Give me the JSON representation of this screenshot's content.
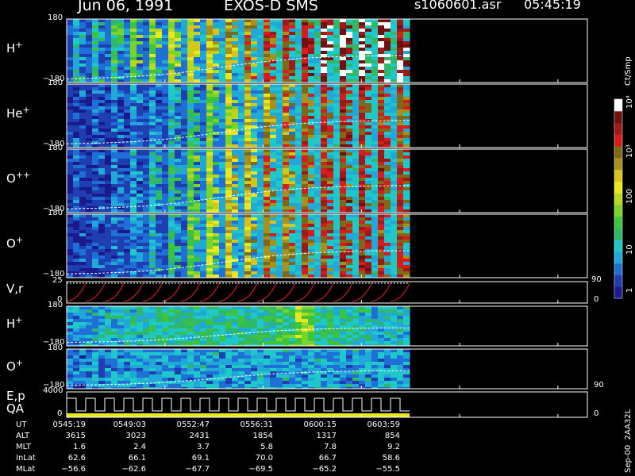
{
  "header": {
    "date": "Jun 06, 1991",
    "instrument": "EXOS-D SMS",
    "file": "s1060601.asr",
    "time": "05:45:19"
  },
  "footer_stamp": "Sep-00  2AA32L",
  "colorbar": {
    "unit": "Ct/Smp",
    "ticks": [
      "1",
      "10",
      "100",
      "10³",
      "10⁴"
    ],
    "colors": [
      "#1a1a8c",
      "#1f3fb0",
      "#1e6fd6",
      "#1fa8d8",
      "#1ec8c8",
      "#2fb86a",
      "#3cc43c",
      "#78d428",
      "#b8d81c",
      "#e8e81c",
      "#d8c418",
      "#a8901c",
      "#806818",
      "#d81c1c",
      "#a01818",
      "#701010",
      "#ffffff"
    ]
  },
  "panels": [
    {
      "label": "H",
      "sup": "+",
      "ymax": "180",
      "ymin": "−180"
    },
    {
      "label": "He",
      "sup": "+",
      "ymax": "180",
      "ymin": "−180"
    },
    {
      "label": "O",
      "sup": "++",
      "ymax": "180",
      "ymin": "−180"
    },
    {
      "label": "O",
      "sup": "+",
      "ymax": "180",
      "ymin": "−180"
    },
    {
      "label": "V,r",
      "sup": "",
      "ymax": "25",
      "ymin": "0",
      "right_top": "90",
      "right_bottom": "0"
    },
    {
      "label": "H",
      "sup": "+",
      "ymax": "180",
      "ymin": "−180"
    },
    {
      "label": "O",
      "sup": "+",
      "ymax": "180",
      "ymin": "−180",
      "right_bottom": "90"
    },
    {
      "label": "E,p",
      "label2": "QA",
      "sup": "",
      "ymax": "4000",
      "ymin": "0",
      "right_bottom": "0"
    }
  ],
  "ephemeris": {
    "rows": [
      {
        "name": "UT",
        "values": [
          "0545:19",
          "0549:03",
          "0552:47",
          "0556:31",
          "0600:15",
          "0603:59"
        ]
      },
      {
        "name": "ALT",
        "values": [
          "3615",
          "3023",
          "2431",
          "1854",
          "1317",
          "854"
        ]
      },
      {
        "name": "MLT",
        "values": [
          "1.6",
          "2.4",
          "3.7",
          "5.8",
          "7.8",
          "9.2"
        ]
      },
      {
        "name": "InLat",
        "values": [
          "62.6",
          "66.1",
          "69.1",
          "70.0",
          "66.7",
          "58.6"
        ]
      },
      {
        "name": "MLat",
        "values": [
          "−56.6",
          "−62.6",
          "−67.7",
          "−69.5",
          "−65.2",
          "−55.5"
        ]
      }
    ]
  },
  "chart_data": {
    "type": "heatmap",
    "x_label": "UT",
    "x_ticks": [
      "0545:19",
      "0549:03",
      "0552:47",
      "0556:31",
      "0600:15",
      "0603:59"
    ],
    "series": [
      {
        "name": "H+",
        "y_range": [
          -180,
          180
        ],
        "intensity_profile": [
          0.25,
          0.3,
          0.35,
          0.4,
          0.45,
          0.5,
          0.55,
          0.6,
          0.65,
          0.7,
          0.75,
          0.8,
          0.85,
          0.9,
          0.95,
          0.97,
          0.95,
          0.9
        ]
      },
      {
        "name": "He+",
        "y_range": [
          -180,
          180
        ],
        "intensity_profile": [
          0.1,
          0.12,
          0.15,
          0.18,
          0.2,
          0.25,
          0.3,
          0.4,
          0.5,
          0.6,
          0.65,
          0.7,
          0.75,
          0.78,
          0.8,
          0.8,
          0.78,
          0.75
        ]
      },
      {
        "name": "O++",
        "y_range": [
          -180,
          180
        ],
        "intensity_profile": [
          0.1,
          0.12,
          0.15,
          0.2,
          0.25,
          0.3,
          0.4,
          0.5,
          0.6,
          0.65,
          0.7,
          0.72,
          0.75,
          0.78,
          0.8,
          0.82,
          0.8,
          0.78
        ]
      },
      {
        "name": "O+",
        "y_range": [
          -180,
          180
        ],
        "intensity_profile": [
          0.1,
          0.12,
          0.15,
          0.2,
          0.25,
          0.3,
          0.4,
          0.5,
          0.6,
          0.65,
          0.7,
          0.72,
          0.75,
          0.78,
          0.8,
          0.8,
          0.78,
          0.76
        ]
      },
      {
        "name": "H+ (low)",
        "y_range": [
          -180,
          180
        ],
        "intensity_profile": [
          0.2,
          0.22,
          0.24,
          0.26,
          0.28,
          0.3,
          0.3,
          0.3,
          0.3,
          0.3,
          0.3,
          0.35,
          0.45,
          0.3,
          0.28,
          0.26,
          0.24,
          0.22
        ]
      },
      {
        "name": "O+ (low)",
        "y_range": [
          -180,
          180
        ],
        "intensity_profile": [
          0.15,
          0.16,
          0.18,
          0.2,
          0.2,
          0.2,
          0.2,
          0.2,
          0.2,
          0.2,
          0.2,
          0.2,
          0.2,
          0.2,
          0.2,
          0.2,
          0.2,
          0.2
        ]
      }
    ],
    "step_count": 18
  }
}
